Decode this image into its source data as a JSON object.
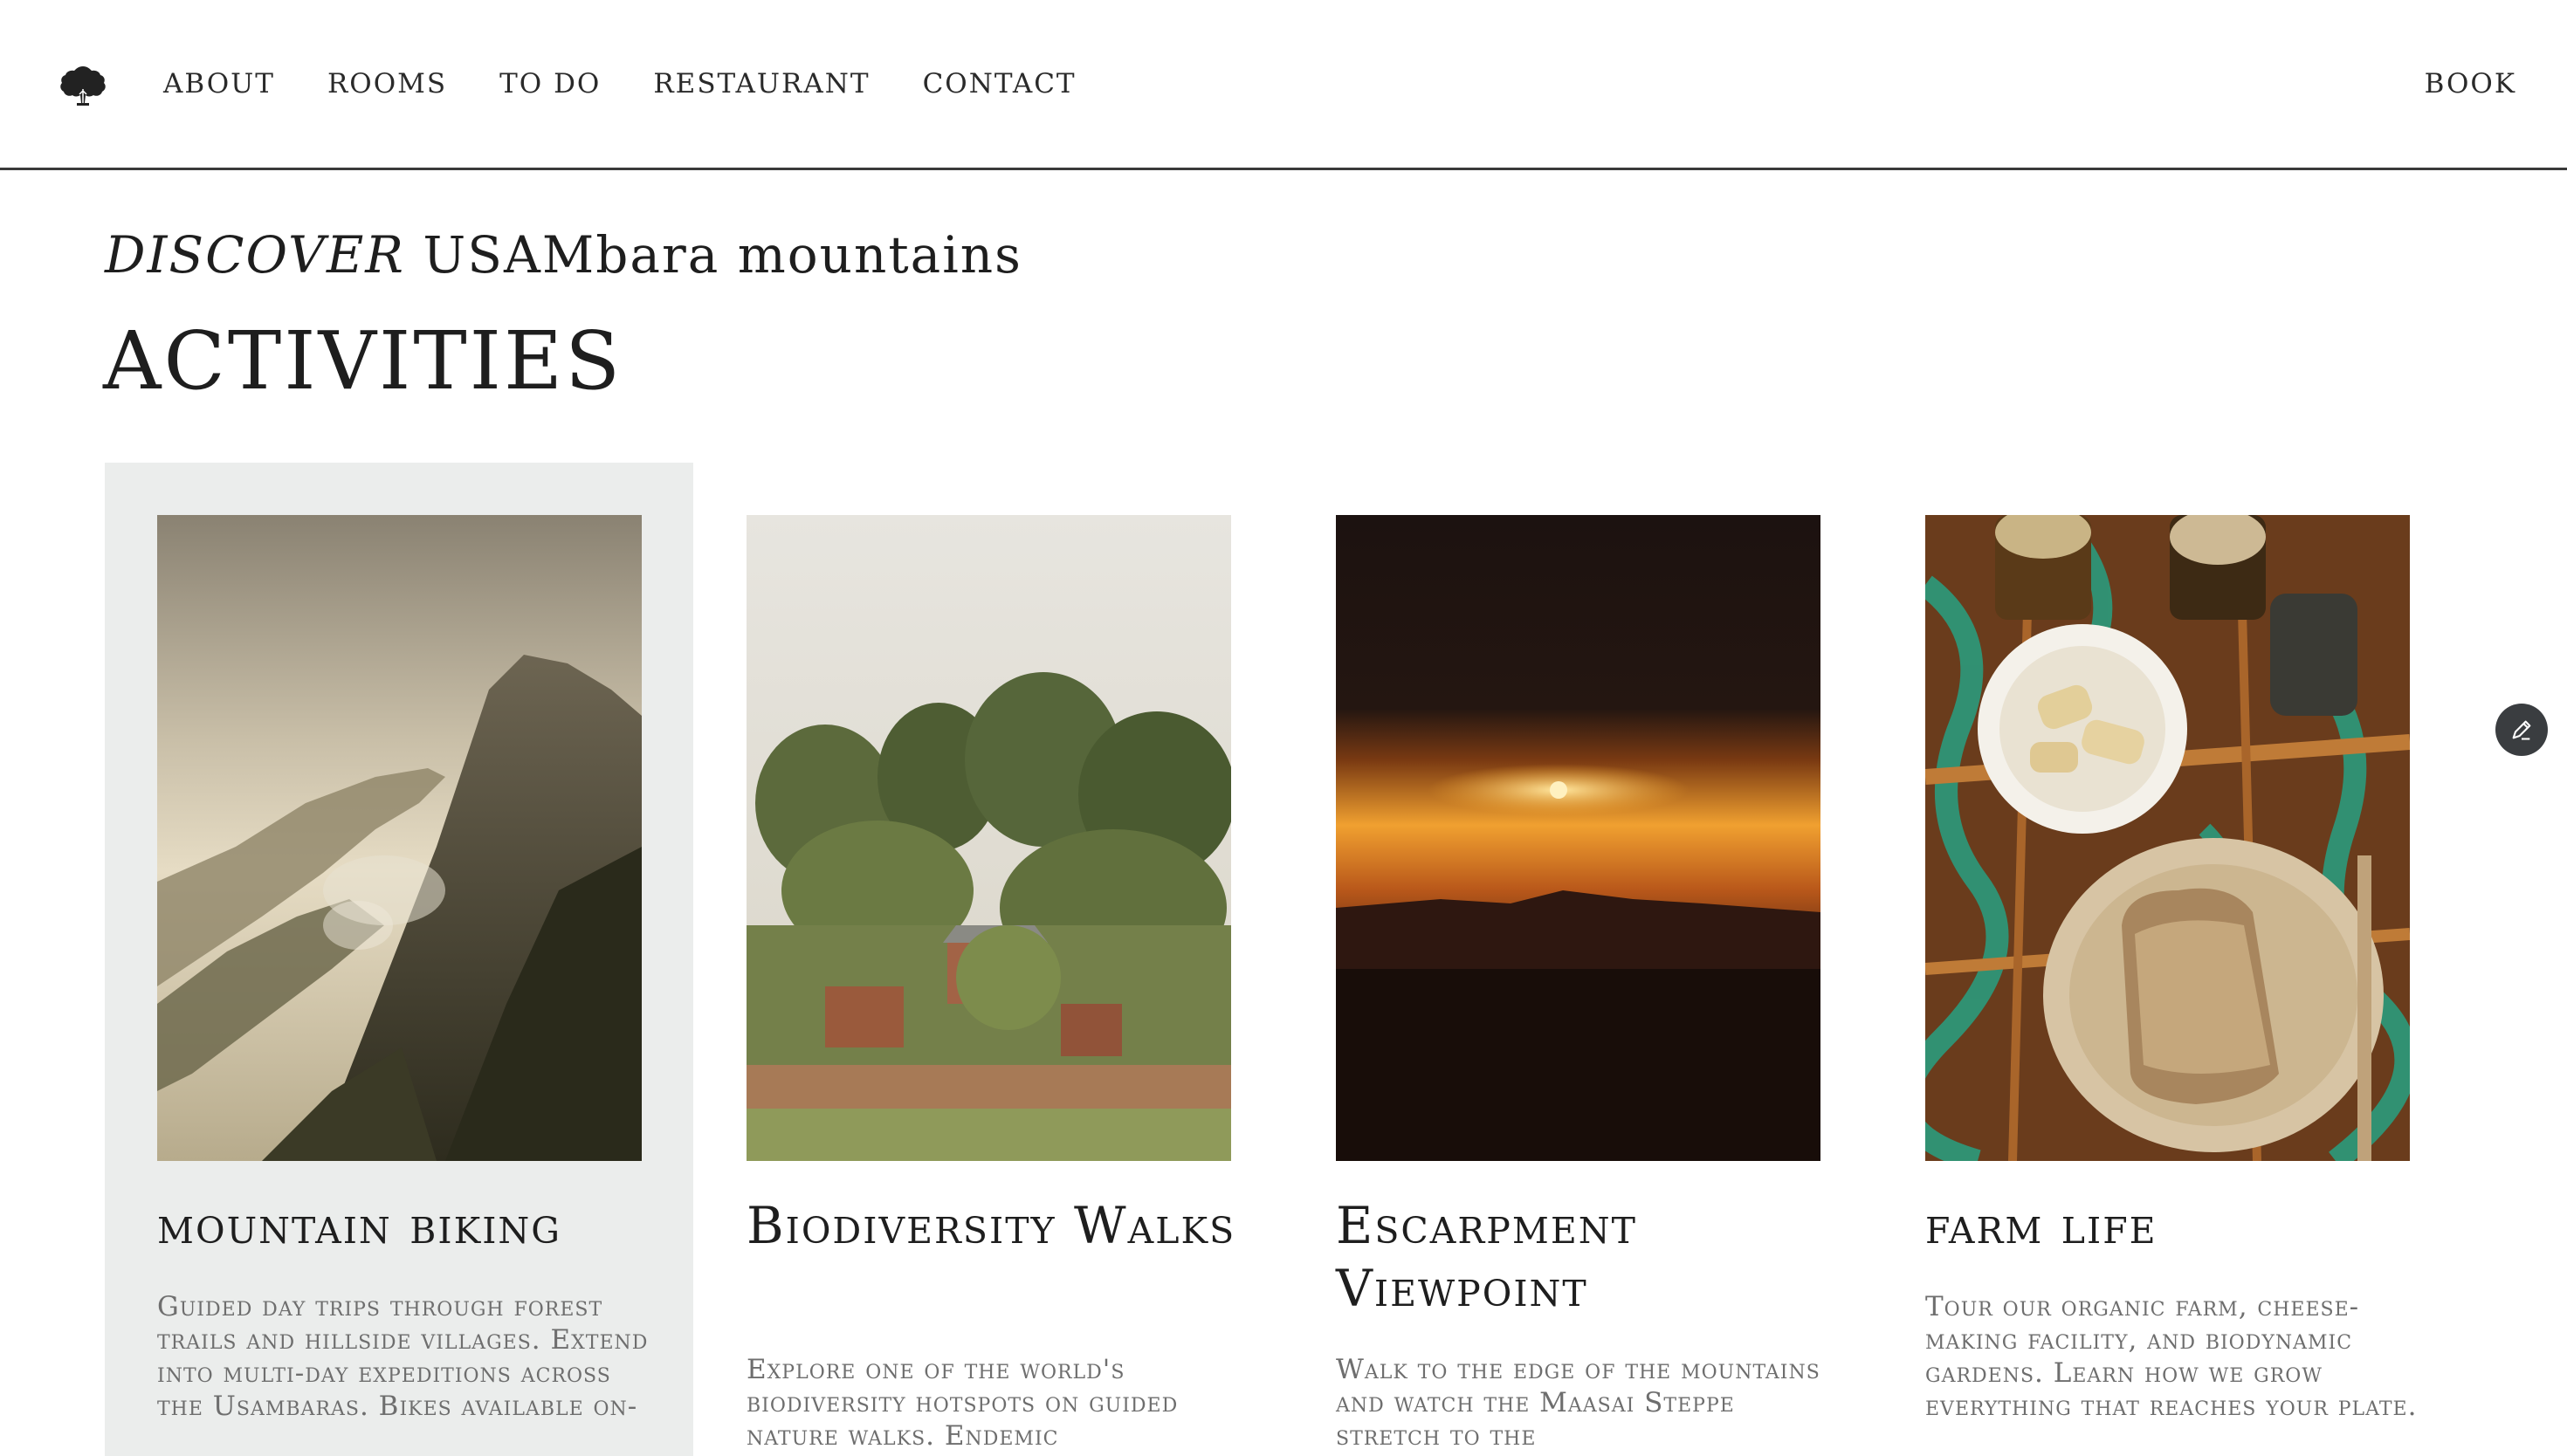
{
  "header": {
    "logo_icon": "tree-logo-icon",
    "nav": [
      {
        "label": "ABOUT"
      },
      {
        "label": "ROOMS"
      },
      {
        "label": "TO DO"
      },
      {
        "label": "RESTAURANT"
      },
      {
        "label": "CONTACT"
      }
    ],
    "book_label": "BOOK"
  },
  "intro": {
    "subtitle_italic": "DISCOVER",
    "subtitle_rest": " USAMbara mountains",
    "title": "ACTIVITIES"
  },
  "activities": [
    {
      "title": "mountain biking",
      "description": "Guided day trips through forest trails and hillside villages. Extend into multi-day expeditions across the Usambaras. Bikes available on-"
    },
    {
      "title": "Biodiversity Walks",
      "description": "Explore one of the world's biodiversity hotspots on guided nature walks. Endemic"
    },
    {
      "title": "Escarpment Viewpoint",
      "description": "Walk to the edge of the mountains and watch the Maasai Steppe stretch to the"
    },
    {
      "title": "farm life",
      "description": "Tour our organic farm, cheese-making facility, and biodynamic gardens. Learn how we grow everything that reaches your plate."
    }
  ],
  "colors": {
    "active_card_bg": "#ebedec",
    "text": "#1e1e1e",
    "muted_text": "#6e6e6e",
    "edit_button": "#3a3d40"
  },
  "edit_icon": "pencil-icon"
}
